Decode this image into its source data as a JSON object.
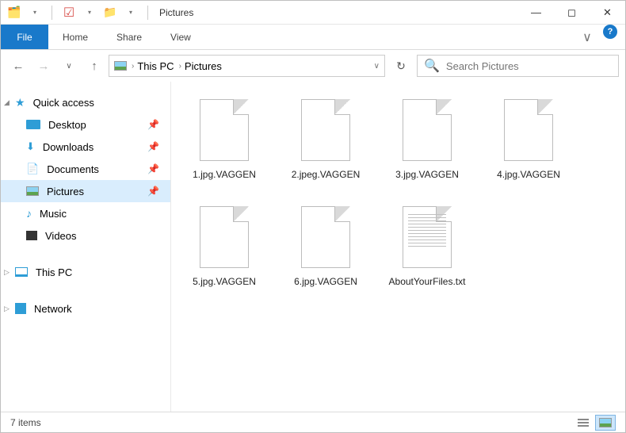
{
  "title": "Pictures",
  "ribbon": {
    "file": "File",
    "home": "Home",
    "share": "Share",
    "view": "View"
  },
  "breadcrumb": {
    "a": "This PC",
    "b": "Pictures"
  },
  "search": {
    "placeholder": "Search Pictures"
  },
  "sidebar": {
    "quick": "Quick access",
    "desktop": "Desktop",
    "downloads": "Downloads",
    "documents": "Documents",
    "pictures": "Pictures",
    "music": "Music",
    "videos": "Videos",
    "thispc": "This PC",
    "network": "Network"
  },
  "files": {
    "f1": "1.jpg.VAGGEN",
    "f2": "2.jpeg.VAGGEN",
    "f3": "3.jpg.VAGGEN",
    "f4": "4.jpg.VAGGEN",
    "f5": "5.jpg.VAGGEN",
    "f6": "6.jpg.VAGGEN",
    "f7": "AboutYourFiles.txt"
  },
  "status": {
    "count": "7 items"
  }
}
